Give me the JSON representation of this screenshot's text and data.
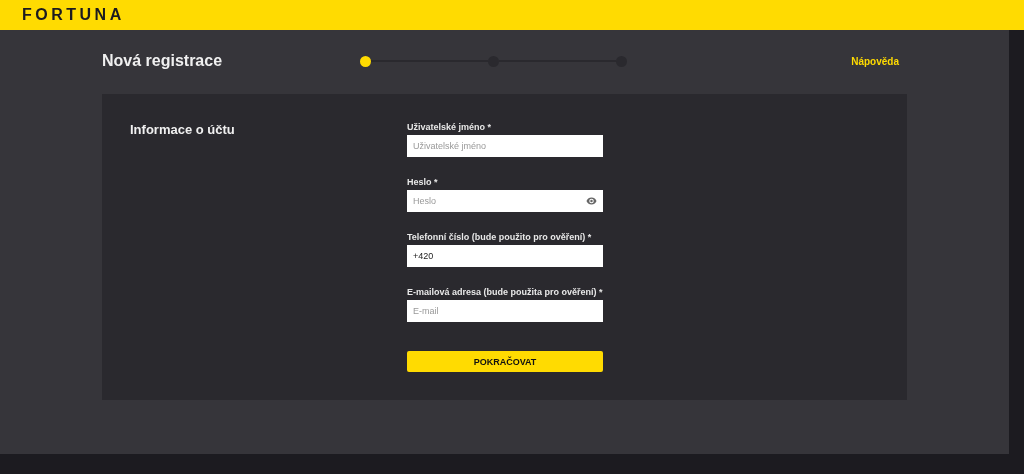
{
  "header": {
    "logo": "FORTUNA"
  },
  "title": "Nová registrace",
  "steps": [
    {
      "active": true
    },
    {
      "active": false
    },
    {
      "active": false
    }
  ],
  "help_link": "Nápověda",
  "section_title": "Informace o účtu",
  "fields": [
    {
      "label": "Uživatelské jméno *",
      "kind": "text",
      "placeholder": "Uživatelské jméno"
    },
    {
      "label": "Heslo *",
      "kind": "password",
      "placeholder": "Heslo"
    },
    {
      "label": "Telefonní číslo (bude použito pro ověření) *",
      "kind": "text",
      "value": "+420"
    },
    {
      "label": "E-mailová adresa (bude použita pro ověření) *",
      "kind": "text",
      "placeholder": "E-mail"
    }
  ],
  "submit_button": "POKRAČOVAT"
}
